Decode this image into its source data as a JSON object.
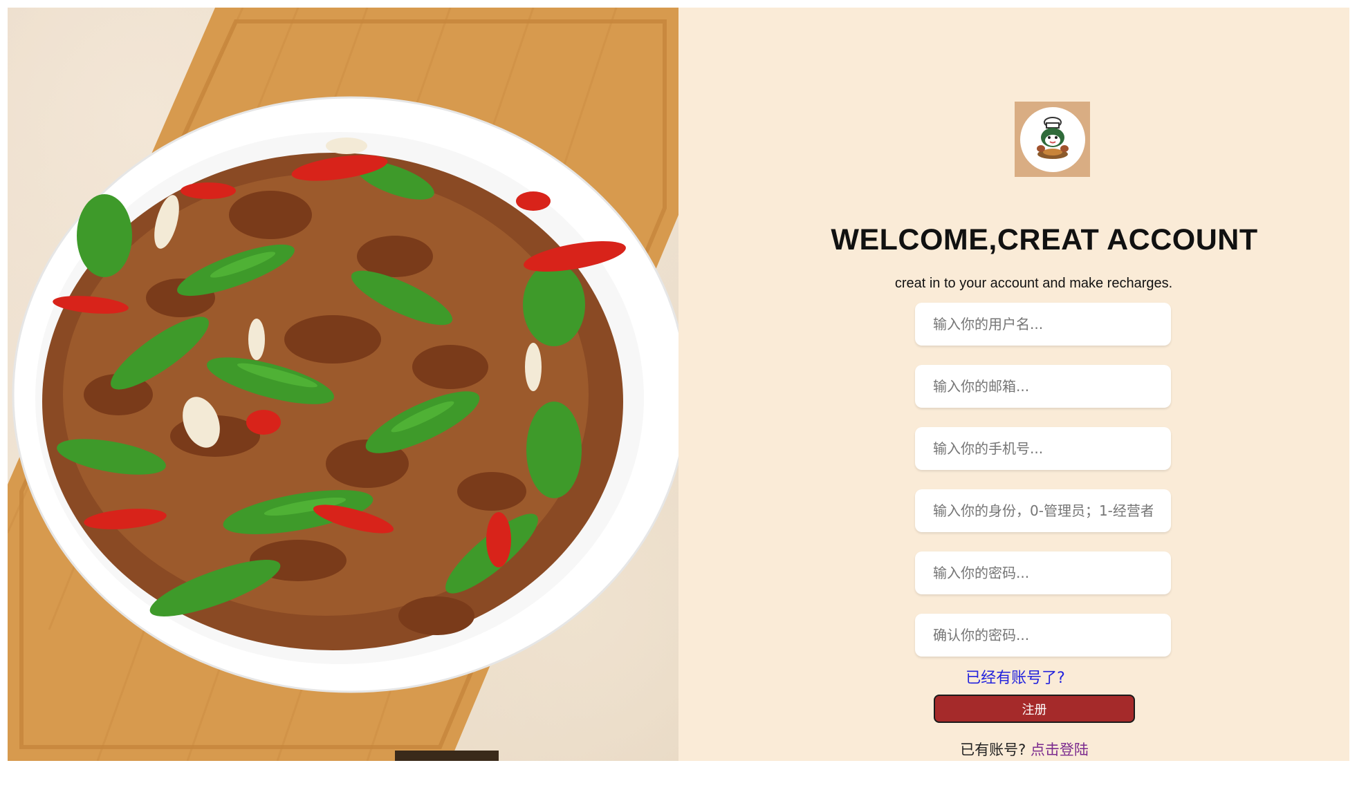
{
  "hero_image": {
    "alt": "food-photo"
  },
  "logo": {
    "icon": "cat-chef-logo-icon"
  },
  "heading": {
    "title": "WELCOME,CREAT ACCOUNT",
    "subtitle": "creat in to your account and make recharges."
  },
  "form": {
    "username_placeholder": "输入你的用户名...",
    "email_placeholder": "输入你的邮箱...",
    "phone_placeholder": "输入你的手机号...",
    "role_placeholder": "输入你的身份，0-管理员；1-经营者",
    "password_placeholder": "输入你的密码...",
    "confirm_password_placeholder": "确认你的密码...",
    "have_account_link": "已经有账号了?",
    "register_button": "注册"
  },
  "footer": {
    "prompt": "已有账号?",
    "login_link": "点击登陆"
  },
  "colors": {
    "panel_bg": "#faebd7",
    "button_bg": "#a52a2a",
    "link_blue": "#2222dd",
    "link_purple": "#7b2a8e"
  }
}
